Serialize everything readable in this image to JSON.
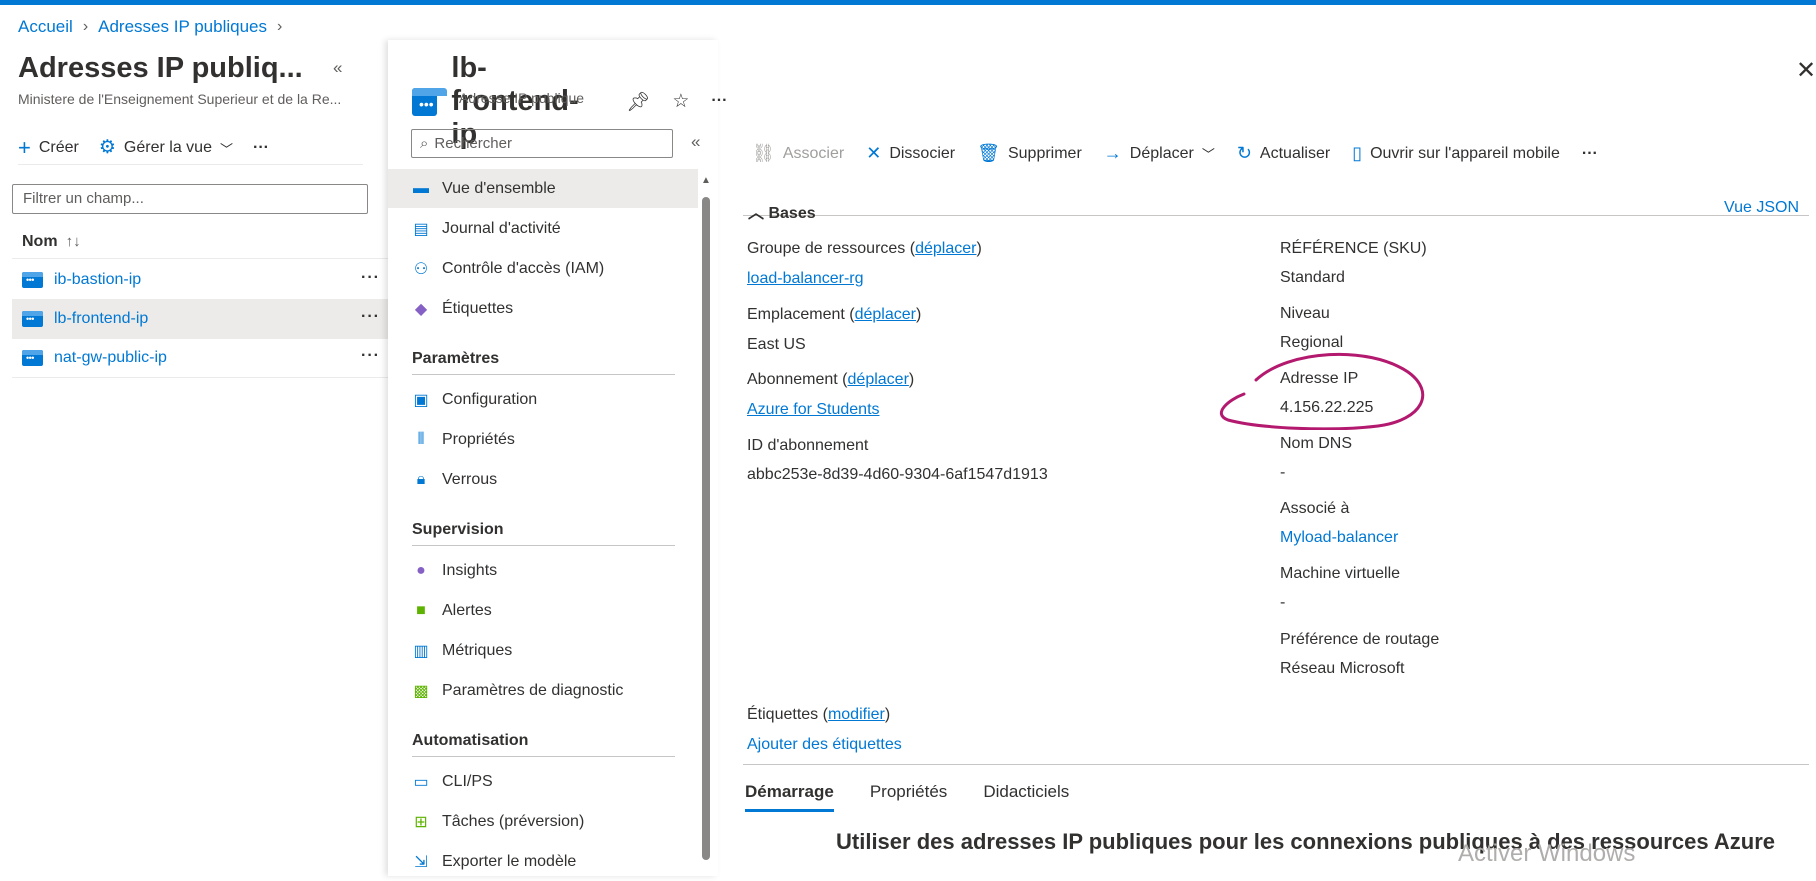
{
  "breadcrumb": {
    "home": "Accueil",
    "section": "Adresses IP publiques"
  },
  "list_pane": {
    "title": "Adresses IP publiq...",
    "subtitle": "Ministere de l'Enseignement Superieur et de la Re...",
    "create_label": "Créer",
    "manage_view_label": "Gérer la vue",
    "filter_placeholder": "Filtrer un champ...",
    "column_name": "Nom",
    "rows": [
      {
        "name": "ib-bastion-ip"
      },
      {
        "name": "lb-frontend-ip"
      },
      {
        "name": "nat-gw-public-ip"
      }
    ]
  },
  "resource": {
    "name": "lb-frontend-ip",
    "type": "Adresse IP publique",
    "search_placeholder": "Rechercher"
  },
  "menu": {
    "top": [
      "Vue d'ensemble",
      "Journal d'activité",
      "Contrôle d'accès (IAM)",
      "Étiquettes"
    ],
    "sections": [
      {
        "title": "Paramètres",
        "items": [
          "Configuration",
          "Propriétés",
          "Verrous"
        ]
      },
      {
        "title": "Supervision",
        "items": [
          "Insights",
          "Alertes",
          "Métriques",
          "Paramètres de diagnostic"
        ]
      },
      {
        "title": "Automatisation",
        "items": [
          "CLI/PS",
          "Tâches (préversion)",
          "Exporter le modèle"
        ]
      }
    ]
  },
  "toolbar": {
    "associate": "Associer",
    "dissociate": "Dissocier",
    "delete": "Supprimer",
    "move": "Déplacer",
    "refresh": "Actualiser",
    "mobile": "Ouvrir sur l'appareil mobile"
  },
  "essentials": {
    "section_title": "Bases",
    "json_view": "Vue JSON",
    "move_link": "déplacer",
    "modify_link": "modifier",
    "left": {
      "resource_group_label": "Groupe de ressources",
      "resource_group_value": "load-balancer-rg",
      "location_label": "Emplacement",
      "location_value": "East US",
      "subscription_label": "Abonnement",
      "subscription_value": "Azure for Students",
      "subscription_id_label": "ID d'abonnement",
      "subscription_id_value": "abbc253e-8d39-4d60-9304-6af1547d1913"
    },
    "right": {
      "sku_label": "RÉFÉRENCE (SKU)",
      "sku_value": "Standard",
      "tier_label": "Niveau",
      "tier_value": "Regional",
      "ip_label": "Adresse IP",
      "ip_value": "4.156.22.225",
      "dns_label": "Nom DNS",
      "dns_value": "-",
      "associated_label": "Associé à",
      "associated_value": "Myload-balancer",
      "vm_label": "Machine virtuelle",
      "vm_value": "-",
      "routing_label": "Préférence de routage",
      "routing_value": "Réseau Microsoft"
    },
    "tags_label": "Étiquettes",
    "add_tags": "Ajouter des étiquettes"
  },
  "tabs": [
    "Démarrage",
    "Propriétés",
    "Didacticiels"
  ],
  "getting_started_title": "Utiliser des adresses IP publiques pour les connexions publiques à des ressources Azure",
  "watermark": "Activer Windows",
  "annotation_color": "#b3196e",
  "accent_color": "#0078d4"
}
